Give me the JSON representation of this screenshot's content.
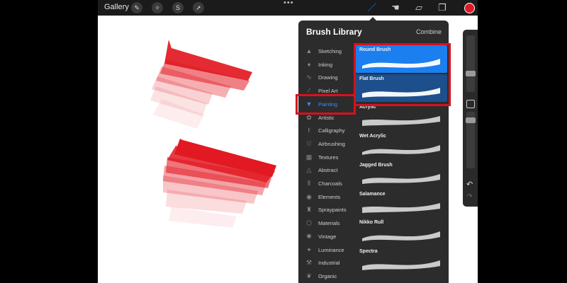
{
  "toolbar": {
    "gallery_label": "Gallery",
    "left_tools": [
      {
        "icon": "wrench-icon",
        "glyph": "✎"
      },
      {
        "icon": "magic-wand-icon",
        "glyph": "✧"
      },
      {
        "icon": "selection-icon",
        "glyph": "S"
      },
      {
        "icon": "transform-icon",
        "glyph": "➚"
      }
    ],
    "more_label": "•••",
    "right_tools": [
      {
        "icon": "brush-icon",
        "glyph": "／",
        "active": true
      },
      {
        "icon": "smudge-icon",
        "glyph": "☚"
      },
      {
        "icon": "eraser-icon",
        "glyph": "▱"
      },
      {
        "icon": "layers-icon",
        "glyph": "❐"
      }
    ],
    "current_color": "#e21922"
  },
  "brush_library": {
    "title": "Brush Library",
    "combine_label": "Combine",
    "categories": [
      {
        "label": "Sketching",
        "icon": "sketching-icon",
        "glyph": "▲"
      },
      {
        "label": "Inking",
        "icon": "inking-icon",
        "glyph": "♦"
      },
      {
        "label": "Drawing",
        "icon": "drawing-icon",
        "glyph": "∿"
      },
      {
        "label": "Pixel Art",
        "icon": "pixel-art-icon",
        "glyph": "⁄"
      },
      {
        "label": "Painting",
        "icon": "painting-icon",
        "glyph": "▼",
        "selected": true
      },
      {
        "label": "Artistic",
        "icon": "artistic-icon",
        "glyph": "✿"
      },
      {
        "label": "Calligraphy",
        "icon": "calligraphy-icon",
        "glyph": "ℓ"
      },
      {
        "label": "Airbrushing",
        "icon": "airbrushing-icon",
        "glyph": "⛆"
      },
      {
        "label": "Textures",
        "icon": "textures-icon",
        "glyph": "▦"
      },
      {
        "label": "Abstract",
        "icon": "abstract-icon",
        "glyph": "△"
      },
      {
        "label": "Charcoals",
        "icon": "charcoals-icon",
        "glyph": "⦀"
      },
      {
        "label": "Elements",
        "icon": "elements-icon",
        "glyph": "◉"
      },
      {
        "label": "Spraypaints",
        "icon": "spraypaints-icon",
        "glyph": "♜"
      },
      {
        "label": "Materials",
        "icon": "materials-icon",
        "glyph": "⬡"
      },
      {
        "label": "Vintage",
        "icon": "vintage-icon",
        "glyph": "✺"
      },
      {
        "label": "Luminance",
        "icon": "luminance-icon",
        "glyph": "✦"
      },
      {
        "label": "Industrial",
        "icon": "industrial-icon",
        "glyph": "⚒"
      },
      {
        "label": "Organic",
        "icon": "organic-icon",
        "glyph": "❦"
      }
    ],
    "brushes": [
      {
        "name": "Round Brush",
        "style": "round"
      },
      {
        "name": "Flat Brush",
        "style": "flat"
      },
      {
        "name": "Acrylic",
        "style": "plain"
      },
      {
        "name": "Wet Acrylic",
        "style": "plain"
      },
      {
        "name": "Jagged Brush",
        "style": "plain"
      },
      {
        "name": "Salamance",
        "style": "plain"
      },
      {
        "name": "Nikko Rull",
        "style": "plain"
      },
      {
        "name": "Spectra",
        "style": "plain"
      }
    ]
  },
  "accent_colors": {
    "selection": "#1b7ff0",
    "highlight_box": "#d7111d",
    "paint": "#e21922"
  }
}
